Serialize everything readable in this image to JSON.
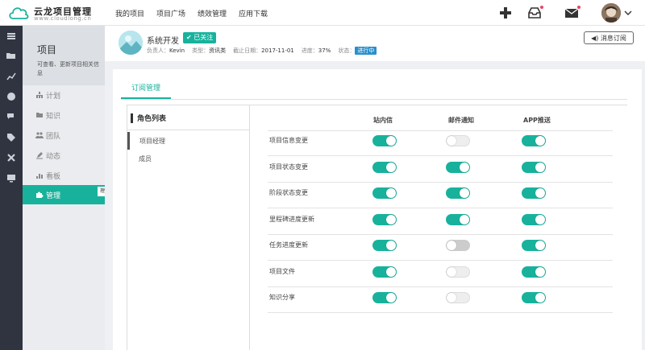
{
  "app": {
    "title": "云龙项目管理",
    "url": "www.cloudlong.cn"
  },
  "topnav": [
    {
      "label": "我的项目"
    },
    {
      "label": "项目广场"
    },
    {
      "label": "绩效管理"
    },
    {
      "label": "应用下载"
    }
  ],
  "icons": {
    "add": "plus-icon",
    "inbox": "inbox-icon",
    "mail": "mail-icon",
    "avatar": "avatar",
    "caret": "chevron-down-icon"
  },
  "sidebar": {
    "title": "项目",
    "desc": "可查看、更新项目相关信息",
    "items": [
      {
        "label": "计划",
        "icon": "sitemap-icon"
      },
      {
        "label": "知识",
        "icon": "folder-icon"
      },
      {
        "label": "团队",
        "icon": "users-icon"
      },
      {
        "label": "动态",
        "icon": "pencil-icon"
      },
      {
        "label": "看板",
        "icon": "bar-chart-icon"
      },
      {
        "label": "管理",
        "icon": "puzzle-icon",
        "active": true
      }
    ],
    "active_tab": "理"
  },
  "project": {
    "name": "系统开发",
    "follow_label": "✔ 已关注",
    "meta": [
      {
        "key": "负责人：",
        "value": "Kevin"
      },
      {
        "key": "类型：",
        "value": "资讯类"
      },
      {
        "key": "截止日期：",
        "value": "2017-11-01"
      },
      {
        "key": "进度：",
        "value": "37%"
      }
    ],
    "status_key": "状态：",
    "status": "进行中",
    "subscribe_label": "◀) 消息订阅"
  },
  "tab": "订阅管理",
  "roles": {
    "title": "角色列表",
    "items": [
      "项目经理",
      "成员"
    ]
  },
  "table": {
    "headers": [
      "站内信",
      "邮件通知",
      "APP推送"
    ],
    "rows": [
      {
        "label": "项目信息变更",
        "states": [
          "on",
          "off",
          "on"
        ]
      },
      {
        "label": "项目状态变更",
        "states": [
          "on",
          "on",
          "on"
        ]
      },
      {
        "label": "阶段状态变更",
        "states": [
          "on",
          "on",
          "on"
        ]
      },
      {
        "label": "里程碑进度更新",
        "states": [
          "on",
          "on",
          "on"
        ]
      },
      {
        "label": "任务进度更新",
        "states": [
          "on",
          "off",
          "on"
        ]
      },
      {
        "label": "项目文件",
        "states": [
          "on",
          "off",
          "on"
        ]
      },
      {
        "label": "知识分享",
        "states": [
          "on",
          "off",
          "on"
        ]
      }
    ]
  },
  "colors": {
    "accent": "#18b29c",
    "rail": "#2f3440",
    "status": "#2a8fcc",
    "badge": "#e8436b"
  }
}
